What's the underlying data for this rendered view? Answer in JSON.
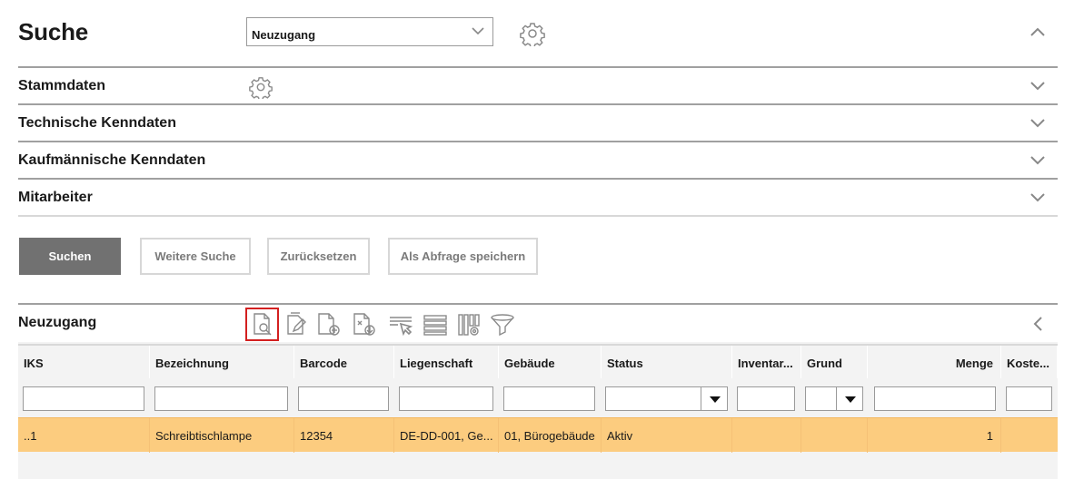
{
  "header": {
    "title": "Suche",
    "query_select_value": "Neuzugang"
  },
  "sections": [
    {
      "label": "Stammdaten"
    },
    {
      "label": "Technische Kenndaten"
    },
    {
      "label": "Kaufmännische Kenndaten"
    },
    {
      "label": "Mitarbeiter"
    }
  ],
  "actions": {
    "search": "Suchen",
    "further_search": "Weitere Suche",
    "reset": "Zurücksetzen",
    "save_query": "Als Abfrage speichern"
  },
  "results": {
    "title": "Neuzugang",
    "toolbar_icons": [
      "document-search-icon",
      "document-edit-icon",
      "document-add-icon",
      "document-download-icon",
      "select-cursor-icon",
      "rows-icon",
      "columns-settings-icon",
      "filter-icon"
    ],
    "columns": [
      "IKS",
      "Bezeichnung",
      "Barcode",
      "Liegenschaft",
      "Gebäude",
      "Status",
      "Inventar...",
      "Grund",
      "Menge",
      "Koste..."
    ],
    "rows": [
      {
        "iks": "..1",
        "bezeichnung": "Schreibtischlampe",
        "barcode": "12354",
        "liegenschaft": "DE-DD-001, Ge...",
        "gebaeude": "01, Bürogebäude",
        "status": "Aktiv",
        "inventar": "",
        "grund": "",
        "menge": "1",
        "kosten": ""
      }
    ]
  },
  "colors": {
    "primary_button": "#717171",
    "selected_row": "#fccc7f",
    "active_icon_border": "#d32020"
  }
}
